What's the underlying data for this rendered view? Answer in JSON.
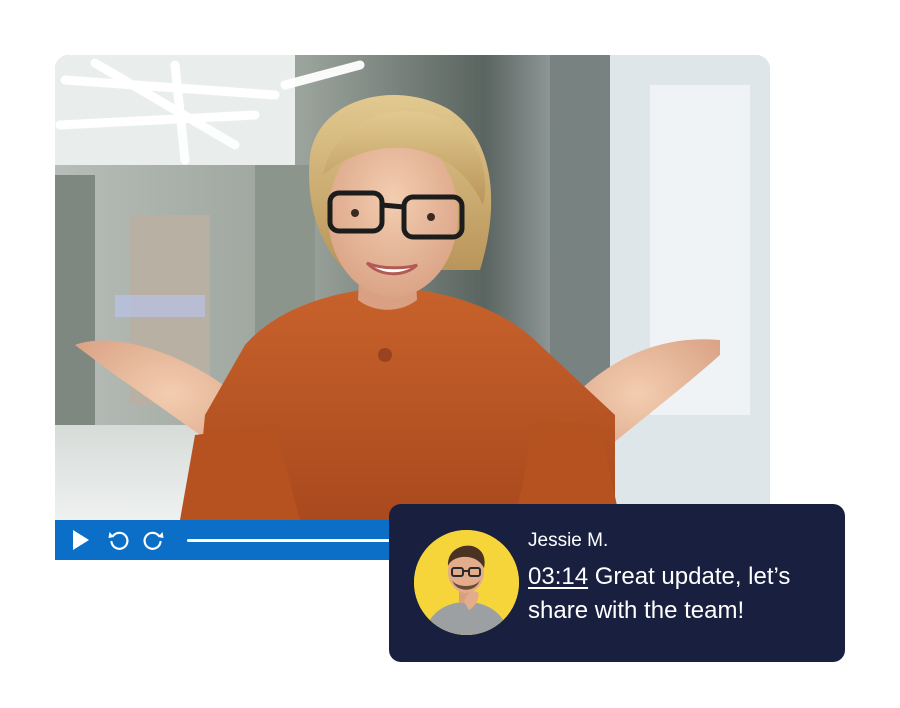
{
  "player": {
    "progress_fraction": 0.4,
    "accent_color": "#0b6fc7",
    "controls": {
      "play_icon": "play-icon",
      "rewind_icon": "rewind-icon",
      "forward_icon": "forward-icon"
    }
  },
  "comment": {
    "author": "Jessie M.",
    "timestamp": "03:14",
    "text": " Great update, let’s share with the team!",
    "avatar_icon": "user-avatar",
    "background_color": "#19203f"
  }
}
